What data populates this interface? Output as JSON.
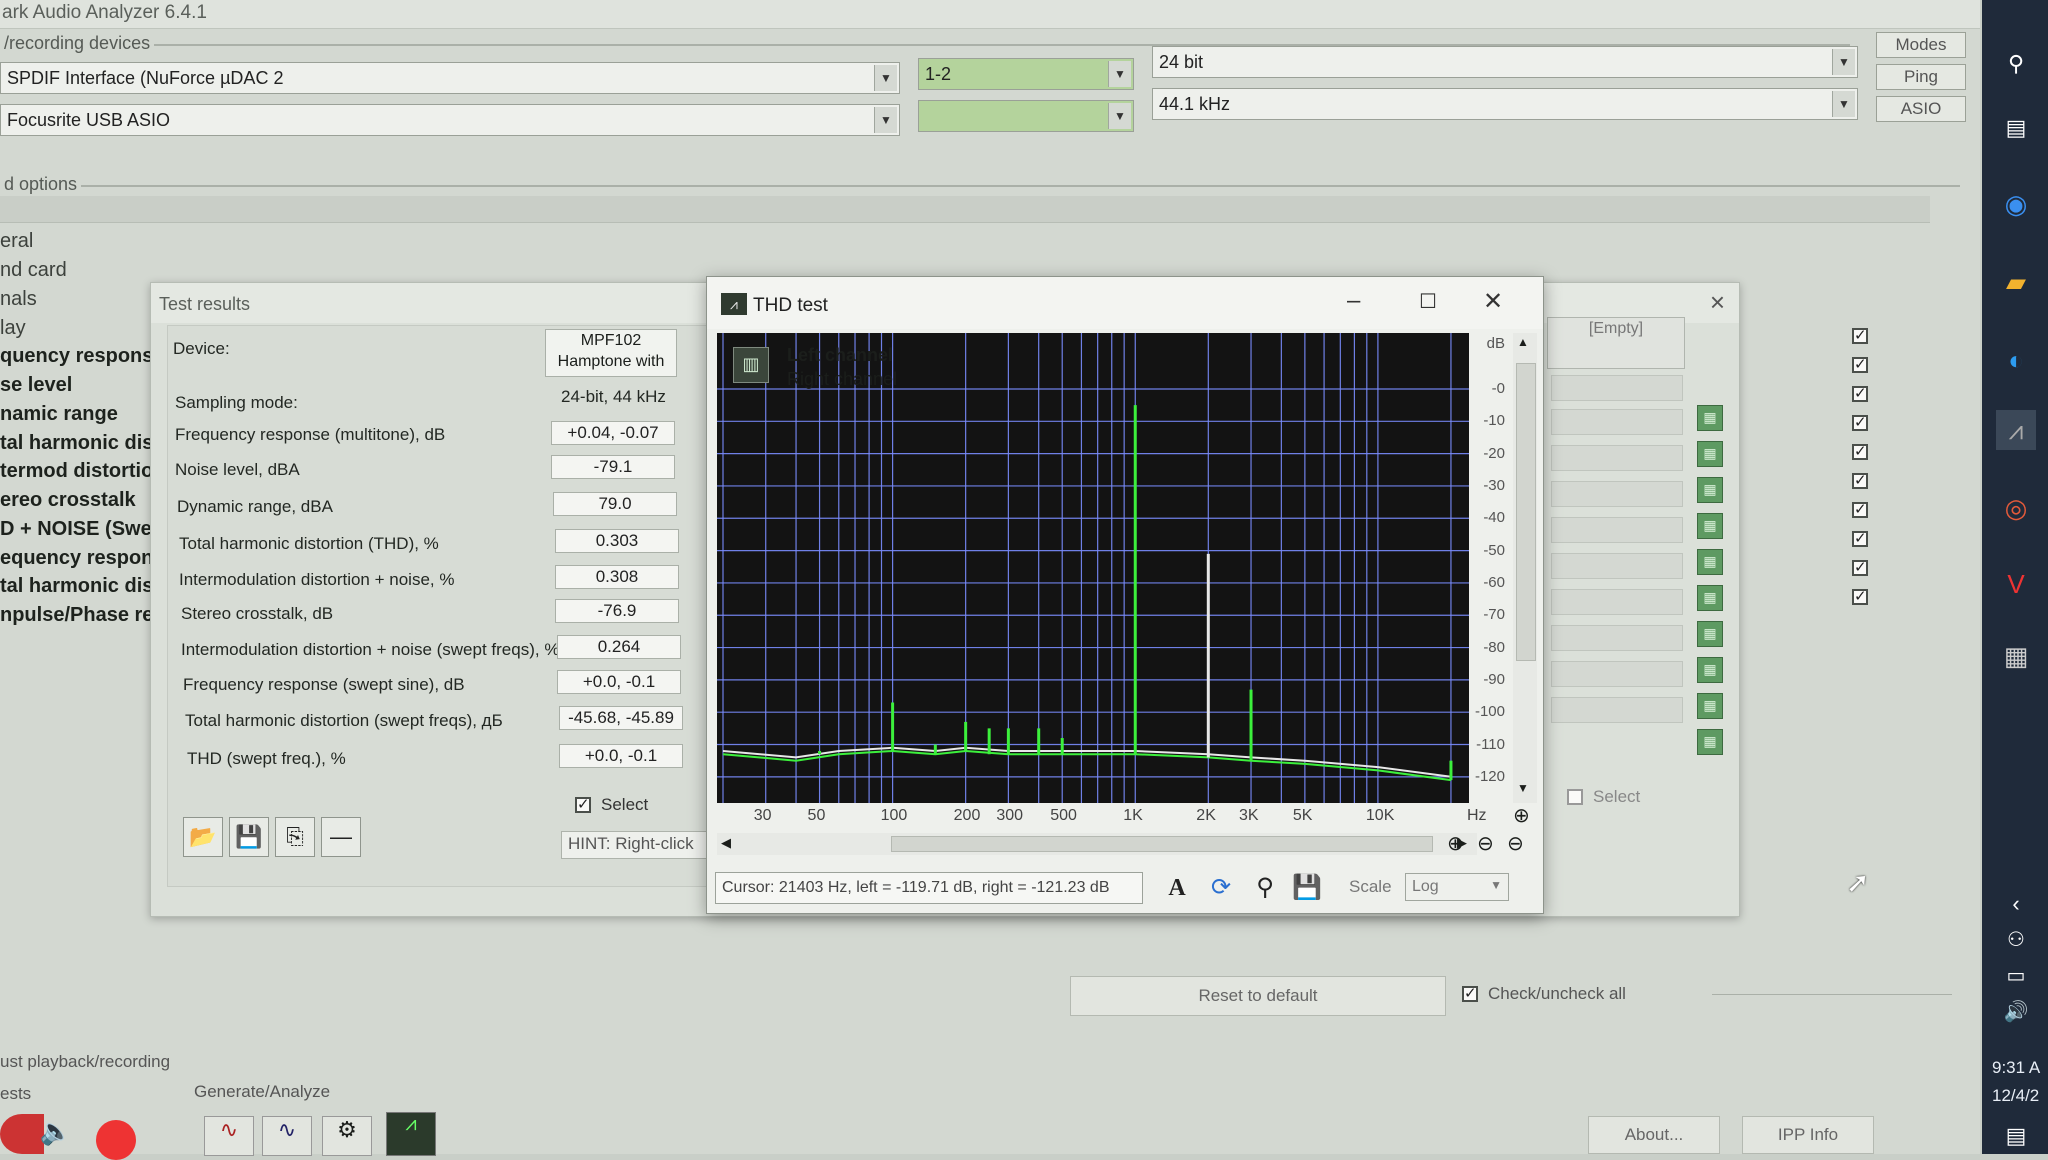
{
  "app": {
    "title": "ark Audio Analyzer 6.4.1"
  },
  "devices": {
    "group_label": "/recording devices",
    "playback_device": "SPDIF Interface (NuForce µDAC 2",
    "recording_device": "Focusrite USB ASIO",
    "channels": "1-2",
    "channels2": "",
    "bit_depth": "24 bit",
    "sample_rate": "44.1 kHz",
    "buttons": [
      "Modes",
      "Ping",
      "ASIO"
    ]
  },
  "options": {
    "group_label": "d options",
    "items": [
      "eral",
      "nd card",
      "nals",
      "lay",
      "quency respons",
      "se level",
      "namic range",
      "tal harmonic dist",
      "termod distortio",
      "ereo crosstalk",
      "D + NOISE (Swe",
      "equency respons",
      "tal harmonic dist",
      "npulse/Phase res"
    ]
  },
  "test_results": {
    "title": "Test results",
    "device_label": "Device:",
    "device_value_line1": "MPF102",
    "device_value_line2": "Hamptone with",
    "sampling_label": "Sampling mode:",
    "sampling_value": "24-bit, 44 kHz",
    "rows": [
      {
        "label": "Frequency response (multitone), dB",
        "value": "+0.04, -0.07"
      },
      {
        "label": "Noise level, dBA",
        "value": "-79.1"
      },
      {
        "label": "Dynamic range, dBA",
        "value": "79.0"
      },
      {
        "label": "Total harmonic distortion (THD), %",
        "value": "0.303"
      },
      {
        "label": "Intermodulation distortion + noise, %",
        "value": "0.308"
      },
      {
        "label": "Stereo crosstalk, dB",
        "value": "-76.9"
      },
      {
        "label": "Intermodulation distortion + noise (swept freqs), %",
        "value": "0.264"
      },
      {
        "label": "Frequency response (swept sine), dB",
        "value": "+0.0, -0.1"
      },
      {
        "label": "Total harmonic distortion (swept freqs), дБ",
        "value": "-45.68, -45.89"
      },
      {
        "label": "THD (swept freq.), %",
        "value": "+0.0, -0.1"
      }
    ],
    "select_label": "Select",
    "hint": "HINT: Right-click",
    "side_empty": "[Empty]",
    "side_select": "Select",
    "close": "×"
  },
  "thd": {
    "title": "THD test",
    "legend_left": "Left channel",
    "legend_right": "Right channel",
    "db_unit": "dB",
    "hz_unit": "Hz",
    "db_ticks": [
      "-0",
      "-10",
      "-20",
      "-30",
      "-40",
      "-50",
      "-60",
      "-70",
      "-80",
      "-90",
      "-100",
      "-110",
      "-120"
    ],
    "hz_ticks": [
      "30",
      "50",
      "100",
      "200",
      "300",
      "500",
      "1K",
      "2K",
      "3K",
      "5K",
      "10K"
    ],
    "cursor": "Cursor:  21403 Hz,  left = -119.71 dB,  right = -121.23 dB",
    "scale_label": "Scale",
    "scale_value": "Log",
    "colors": {
      "left": "#e8e8e8",
      "right": "#3cf03c",
      "grid": "#7a8cff"
    }
  },
  "chart_data": {
    "type": "line",
    "title": "",
    "xlabel": "Hz",
    "ylabel": "dB",
    "xscale": "log",
    "xlim": [
      20,
      22000
    ],
    "ylim": [
      -125,
      0
    ],
    "grid": true,
    "legend": "top-left",
    "series": [
      {
        "name": "Left channel",
        "x": [
          20,
          40,
          60,
          100,
          150,
          200,
          300,
          500,
          1000,
          2000,
          3000,
          5000,
          10000,
          20000
        ],
        "y": [
          -112,
          -114,
          -112,
          -111,
          -112,
          -111,
          -112,
          -112,
          -112,
          -113,
          -114,
          -115,
          -117,
          -120
        ]
      },
      {
        "name": "Right channel",
        "x": [
          20,
          40,
          60,
          100,
          150,
          200,
          300,
          500,
          1000,
          2000,
          3000,
          5000,
          10000,
          20000
        ],
        "y": [
          -113,
          -115,
          -113,
          -112,
          -113,
          -112,
          -113,
          -113,
          -113,
          -114,
          -115,
          -116,
          -118,
          -121
        ]
      }
    ],
    "peaks": [
      {
        "x": 50,
        "y": -112
      },
      {
        "x": 100,
        "y": -97
      },
      {
        "x": 150,
        "y": -110
      },
      {
        "x": 200,
        "y": -103
      },
      {
        "x": 250,
        "y": -105
      },
      {
        "x": 300,
        "y": -105
      },
      {
        "x": 400,
        "y": -105
      },
      {
        "x": 500,
        "y": -108
      },
      {
        "x": 1000,
        "y": -5
      },
      {
        "x": 2000,
        "y": -51
      },
      {
        "x": 3000,
        "y": -93
      },
      {
        "x": 20000,
        "y": -115
      }
    ]
  },
  "bottom": {
    "reset": "Reset to default",
    "check_all": "Check/uncheck all",
    "playback_label": "ust playback/recording",
    "tests_label": "ests",
    "generate_label": "Generate/Analyze",
    "about": "About...",
    "ipp": "IPP Info"
  },
  "taskbar": {
    "time": "9:31 A",
    "date": "12/4/2"
  }
}
